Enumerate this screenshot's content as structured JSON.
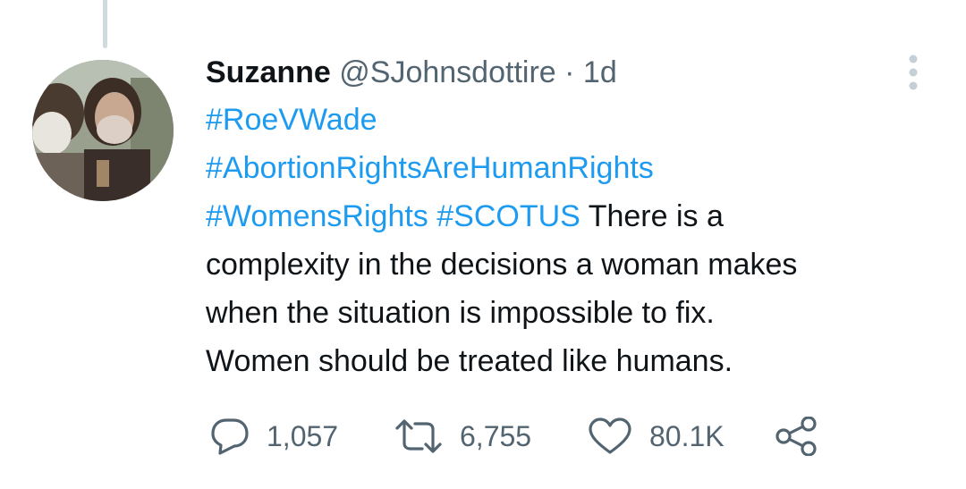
{
  "tweet": {
    "author": {
      "name": "Suzanne",
      "handle": "@SJohnsdottire"
    },
    "separator": "·",
    "time": "1d",
    "lines": [
      [
        {
          "text": "#RoeVWade",
          "type": "hashtag"
        }
      ],
      [
        {
          "text": "#AbortionRightsAreHumanRights",
          "type": "hashtag"
        }
      ],
      [
        {
          "text": "#WomensRights",
          "type": "hashtag"
        },
        {
          "text": " ",
          "type": "text"
        },
        {
          "text": "#SCOTUS",
          "type": "hashtag"
        },
        {
          "text": " There is a",
          "type": "text"
        }
      ],
      [
        {
          "text": "complexity in the decisions a woman makes",
          "type": "text"
        }
      ],
      [
        {
          "text": "when the situation is impossible to fix.",
          "type": "text"
        }
      ],
      [
        {
          "text": "Women should be treated like humans.",
          "type": "text"
        }
      ]
    ]
  },
  "actions": {
    "reply": {
      "count": "1,057",
      "icon": "reply-icon"
    },
    "retweet": {
      "count": "6,755",
      "icon": "retweet-icon"
    },
    "like": {
      "count": "80.1K",
      "icon": "heart-icon"
    },
    "share": {
      "icon": "share-icon"
    }
  },
  "colors": {
    "hashtag": "#1d9bf0",
    "secondary_text": "#536471",
    "primary_text": "#0f1419",
    "thread_line": "#cfd9de"
  }
}
